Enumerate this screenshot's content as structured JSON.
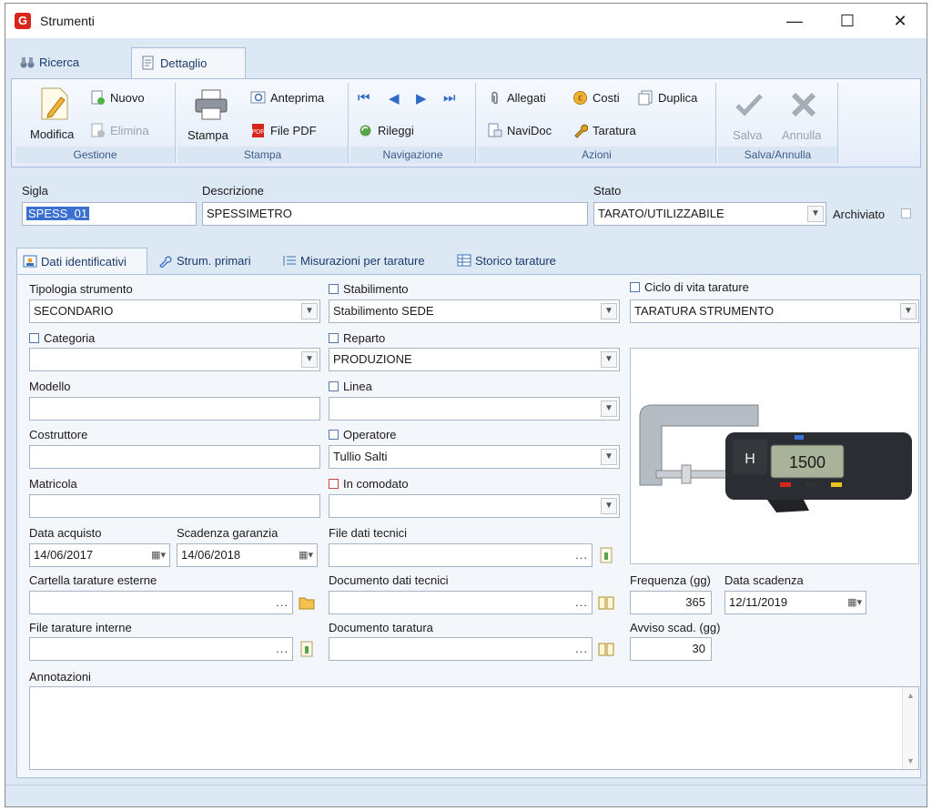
{
  "window": {
    "title": "Strumenti",
    "logo": "G"
  },
  "main_tabs": [
    {
      "label": "Ricerca"
    },
    {
      "label": "Dettaglio"
    }
  ],
  "ribbon": {
    "gestione": {
      "label": "Gestione",
      "modifica": "Modifica",
      "nuovo": "Nuovo",
      "elimina": "Elimina"
    },
    "stampa": {
      "label": "Stampa",
      "stampa": "Stampa",
      "anteprima": "Anteprima",
      "file_pdf": "File PDF"
    },
    "navigazione": {
      "label": "Navigazione",
      "rileggi": "Rileggi"
    },
    "azioni": {
      "label": "Azioni",
      "allegati": "Allegati",
      "costi": "Costi",
      "duplica": "Duplica",
      "navidoc": "NaviDoc",
      "taratura": "Taratura"
    },
    "salva_annulla": {
      "label": "Salva/Annulla",
      "salva": "Salva",
      "annulla": "Annulla"
    }
  },
  "header_form": {
    "sigla_label": "Sigla",
    "sigla_value": "SPESS_01",
    "descrizione_label": "Descrizione",
    "descrizione_value": "SPESSIMETRO",
    "stato_label": "Stato",
    "stato_value": "TARATO/UTILIZZABILE",
    "archiviato_label": "Archiviato"
  },
  "sub_tabs": [
    {
      "label": "Dati identificativi"
    },
    {
      "label": "Strum. primari"
    },
    {
      "label": "Misurazioni per tarature"
    },
    {
      "label": "Storico tarature"
    }
  ],
  "detail": {
    "tipologia_label": "Tipologia strumento",
    "tipologia_value": "SECONDARIO",
    "categoria_label": "Categoria",
    "categoria_value": "",
    "modello_label": "Modello",
    "modello_value": "",
    "costruttore_label": "Costruttore",
    "costruttore_value": "",
    "matricola_label": "Matricola",
    "matricola_value": "",
    "data_acquisto_label": "Data acquisto",
    "data_acquisto_value": "14/06/2017",
    "scadenza_garanzia_label": "Scadenza garanzia",
    "scadenza_garanzia_value": "14/06/2018",
    "cartella_label": "Cartella tarature esterne",
    "cartella_value": "",
    "file_tarature_label": "File tarature interne",
    "file_tarature_value": "",
    "stabilimento_label": "Stabilimento",
    "stabilimento_value": "Stabilimento SEDE",
    "reparto_label": "Reparto",
    "reparto_value": "PRODUZIONE",
    "linea_label": "Linea",
    "linea_value": "",
    "operatore_label": "Operatore",
    "operatore_value": "Tullio Salti",
    "comodato_label": "In comodato",
    "comodato_value": "",
    "file_dati_label": "File dati tecnici",
    "file_dati_value": "",
    "doc_dati_label": "Documento dati tecnici",
    "doc_dati_value": "",
    "doc_taratura_label": "Documento taratura",
    "doc_taratura_value": "",
    "ciclo_label": "Ciclo di vita tarature",
    "ciclo_value": "TARATURA STRUMENTO",
    "frequenza_label": "Frequenza (gg)",
    "frequenza_value": "365",
    "data_scadenza_label": "Data scadenza",
    "data_scadenza_value": "12/11/2019",
    "avviso_label": "Avviso scad. (gg)",
    "avviso_value": "30",
    "annotazioni_label": "Annotazioni",
    "photo_display": "1500"
  },
  "ellipsis": "...",
  "icons": [
    "app-logo-icon",
    "minimize-icon",
    "maximize-icon",
    "close-icon",
    "binoculars-icon",
    "document-icon",
    "edit-icon",
    "new-icon",
    "delete-icon",
    "printer-icon",
    "preview-icon",
    "pdf-icon",
    "first-icon",
    "prev-icon",
    "next-icon",
    "last-icon",
    "refresh-icon",
    "paperclip-icon",
    "coin-icon",
    "duplicate-icon",
    "navidoc-icon",
    "wrench-icon",
    "checkmark-icon",
    "cancel-x-icon",
    "id-card-icon",
    "list-icon",
    "table-icon",
    "folder-icon",
    "book-icon",
    "calendar-icon"
  ]
}
